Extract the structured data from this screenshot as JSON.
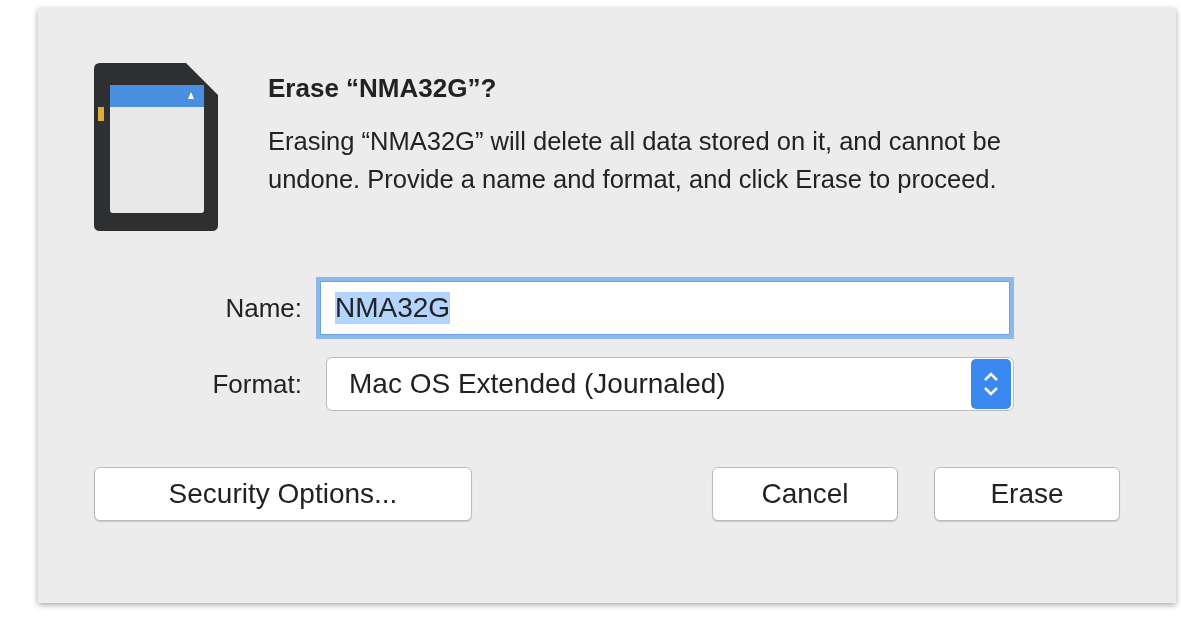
{
  "dialog": {
    "title": "Erase “NMA32G”?",
    "message": "Erasing “NMA32G” will delete all data stored on it, and cannot be undone. Provide a name and format, and click Erase to proceed.",
    "fields": [
      {
        "kind": "text",
        "label": "Name:",
        "value": "NMA32G",
        "focused": true,
        "value_selected": true
      },
      {
        "kind": "popup",
        "label": "Format:",
        "value": "Mac OS Extended (Journaled)"
      }
    ],
    "left_buttons": [
      "Security Options..."
    ],
    "right_buttons": [
      "Cancel",
      "Erase"
    ]
  }
}
